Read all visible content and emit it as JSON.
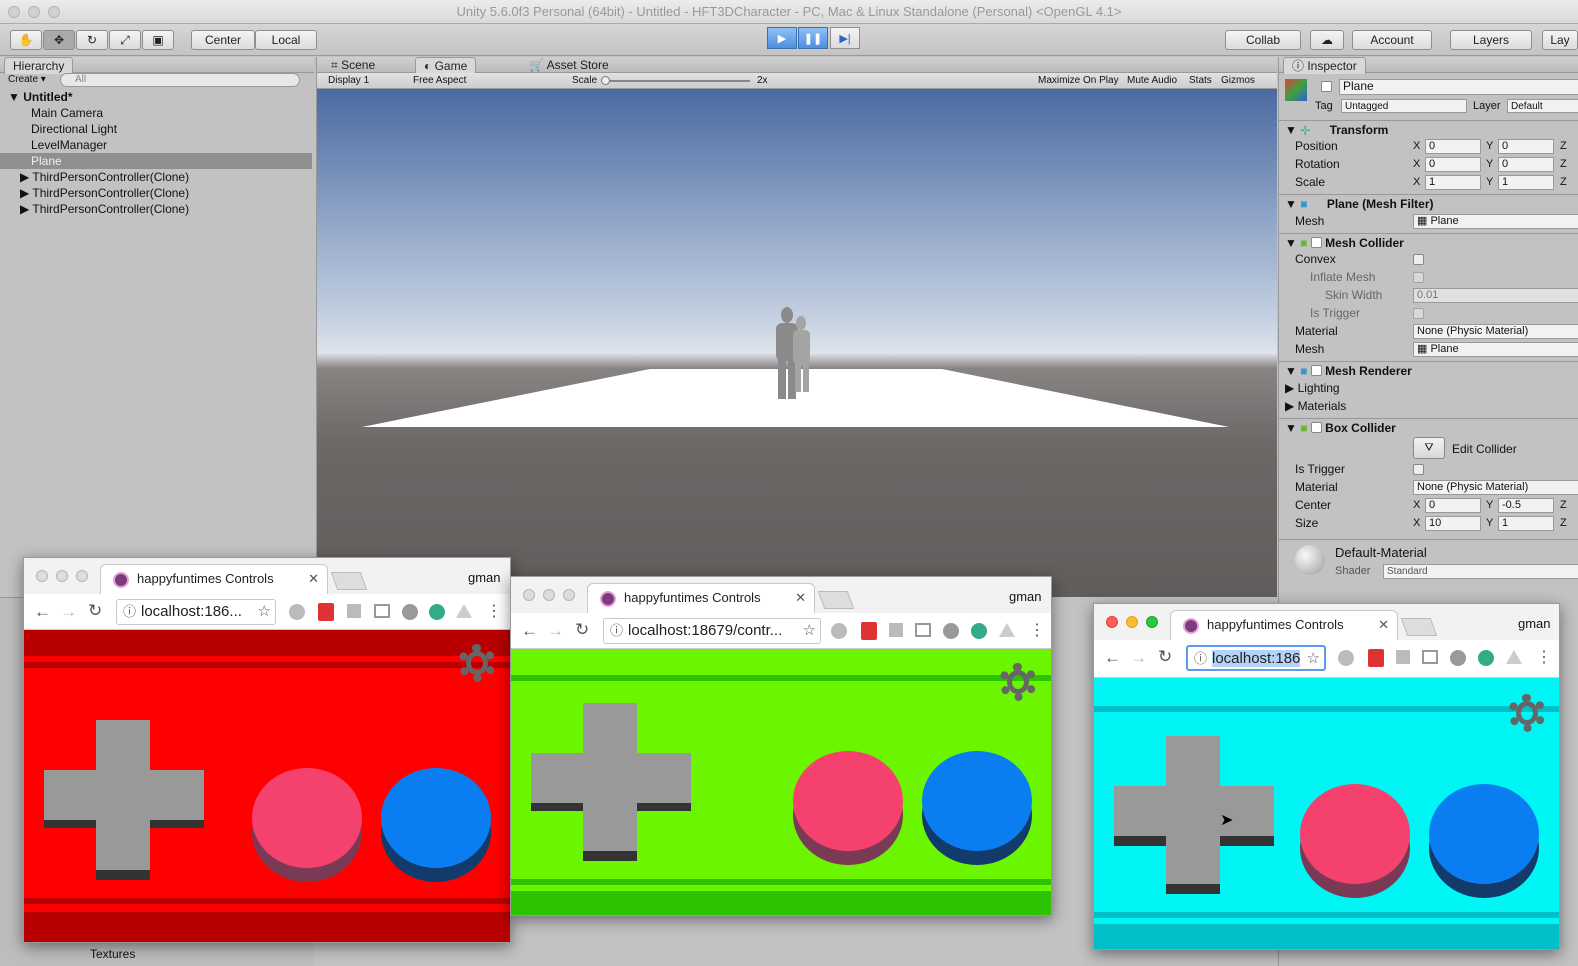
{
  "window": {
    "title": "Unity 5.6.0f3 Personal (64bit) - Untitled - HFT3DCharacter - PC, Mac & Linux Standalone (Personal) <OpenGL 4.1>"
  },
  "toolbar": {
    "center_label": "Center",
    "local_label": "Local",
    "collab_label": "Collab",
    "account_label": "Account",
    "layers_label": "Layers",
    "layout_label": "Lay"
  },
  "hierarchy": {
    "tab": "Hierarchy",
    "create": "Create",
    "search_placeholder": "All",
    "scene": "Untitled*",
    "items": [
      "Main Camera",
      "Directional Light",
      "LevelManager",
      "Plane"
    ],
    "clones": [
      "ThirdPersonController(Clone)",
      "ThirdPersonController(Clone)",
      "ThirdPersonController(Clone)"
    ],
    "project_item": "Textures"
  },
  "game": {
    "tabs": [
      "Scene",
      "Game",
      "Asset Store"
    ],
    "display": "Display 1",
    "aspect": "Free Aspect",
    "scale_label": "Scale",
    "scale_value": "2x",
    "options": [
      "Maximize On Play",
      "Mute Audio",
      "Stats",
      "Gizmos"
    ]
  },
  "inspector": {
    "tab": "Inspector",
    "object_name": "Plane",
    "tag_label": "Tag",
    "tag_value": "Untagged",
    "layer_label": "Layer",
    "layer_value": "Default",
    "transform": {
      "title": "Transform",
      "rows": [
        {
          "label": "Position",
          "x": "0",
          "y": "0"
        },
        {
          "label": "Rotation",
          "x": "0",
          "y": "0"
        },
        {
          "label": "Scale",
          "x": "1",
          "y": "1"
        }
      ]
    },
    "mesh_filter": {
      "title": "Plane (Mesh Filter)",
      "mesh_label": "Mesh",
      "mesh_value": "Plane"
    },
    "mesh_collider": {
      "title": "Mesh Collider",
      "convex": "Convex",
      "inflate": "Inflate Mesh",
      "skin_width": "Skin Width",
      "skin_value": "0.01",
      "is_trigger": "Is Trigger",
      "material": "Material",
      "material_value": "None (Physic Material)",
      "mesh": "Mesh",
      "mesh_value": "Plane"
    },
    "mesh_renderer": {
      "title": "Mesh Renderer",
      "lighting": "Lighting",
      "materials": "Materials"
    },
    "box_collider": {
      "title": "Box Collider",
      "edit": "Edit Collider",
      "is_trigger": "Is Trigger",
      "material": "Material",
      "material_value": "None (Physic Material)",
      "center": "Center",
      "center_x": "0",
      "center_y": "-0.5",
      "size": "Size",
      "size_x": "10",
      "size_y": "1"
    },
    "material": {
      "name": "Default-Material",
      "shader_label": "Shader",
      "shader_value": "Standard"
    }
  },
  "browsers": [
    {
      "tab_title": "happyfuntimes Controls",
      "user": "gman",
      "url": "localhost:186...",
      "color": "#ff0000",
      "dark": "#b80000"
    },
    {
      "tab_title": "happyfuntimes Controls",
      "user": "gman",
      "url": "localhost:18679/contr...",
      "color": "#6cf500",
      "dark": "#2cc300"
    },
    {
      "tab_title": "happyfuntimes Controls",
      "user": "gman",
      "url": "localhost:186",
      "color": "#00f5f5",
      "dark": "#00bfc8"
    }
  ],
  "colors": {
    "pink": "#f5416e",
    "pink_shadow": "#7a3a55",
    "blue": "#0a7df0",
    "blue_shadow": "#123a6a",
    "dpad": "#999999",
    "dpad_shadow": "#333333"
  }
}
